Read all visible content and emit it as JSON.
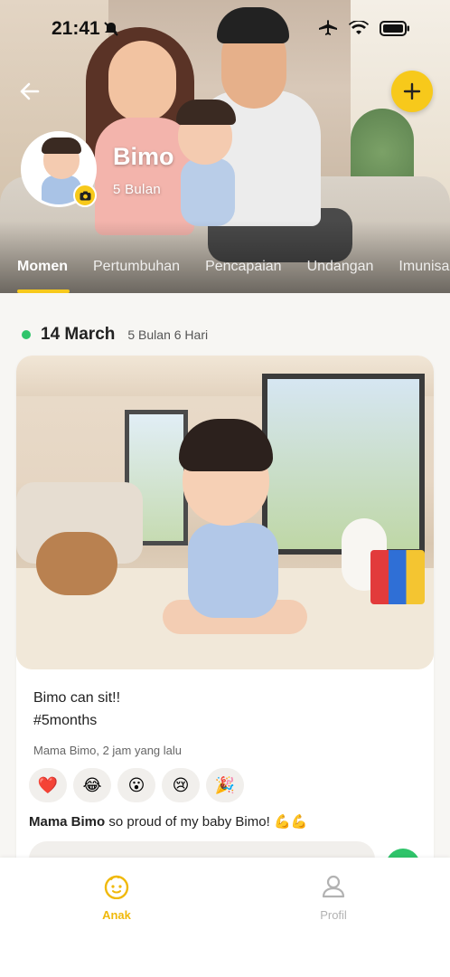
{
  "status_bar": {
    "time": "21:41"
  },
  "header": {
    "child_name": "Bimo",
    "child_age": "5 Bulan",
    "tabs": [
      {
        "label": "Momen",
        "active": true
      },
      {
        "label": "Pertumbuhan",
        "active": false
      },
      {
        "label": "Pencapaian",
        "active": false
      },
      {
        "label": "Undangan",
        "active": false
      },
      {
        "label": "Imunisasi",
        "active": false
      }
    ],
    "accent_color": "#f7c91b"
  },
  "moment": {
    "date": "14 March",
    "age": "5 Bulan 6 Hari",
    "caption": "Bimo can sit!!\n#5months",
    "author_time": "Mama Bimo, 2 jam yang lalu",
    "reactions": [
      "❤️",
      "😂",
      "😮",
      "😢",
      "🎉"
    ],
    "comment": {
      "author": "Mama Bimo",
      "text": " so proud of my baby Bimo! 💪💪"
    },
    "status_color": "#2fc46a"
  },
  "bottom_nav": {
    "items": [
      {
        "label": "Anak",
        "icon": "baby-face-icon",
        "active": true
      },
      {
        "label": "Profil",
        "icon": "person-icon",
        "active": false
      }
    ]
  }
}
